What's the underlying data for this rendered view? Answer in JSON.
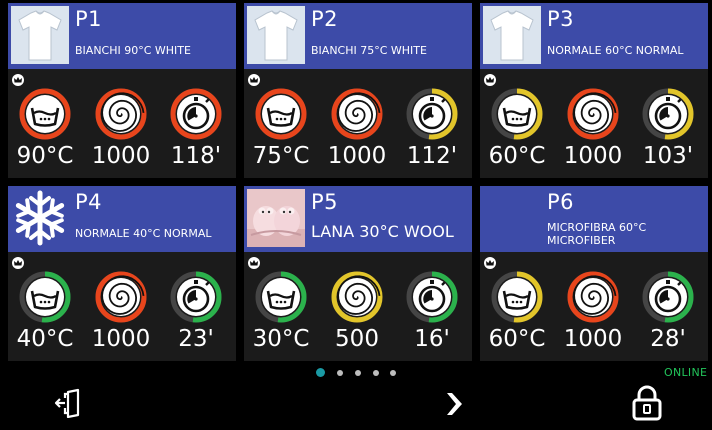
{
  "programs": [
    {
      "number": "P1",
      "name": "BIANCHI 90°C WHITE",
      "thumb": "tshirt-icon",
      "temp": "90°C",
      "spin": "1000",
      "time": "118'",
      "temp_color": "#e8451c",
      "spin_color": "#e8451c",
      "time_color": "#e8451c"
    },
    {
      "number": "P2",
      "name": "BIANCHI 75°C WHITE",
      "thumb": "tshirt-icon",
      "temp": "75°C",
      "spin": "1000",
      "time": "112'",
      "temp_color": "#e8451c",
      "spin_color": "#e8451c",
      "time_color": "#e2c52a"
    },
    {
      "number": "P3",
      "name": "NORMALE 60°C NORMAL",
      "thumb": "tshirt-icon",
      "temp": "60°C",
      "spin": "1000",
      "time": "103'",
      "temp_color": "#e2c52a",
      "spin_color": "#e8451c",
      "time_color": "#e2c52a"
    },
    {
      "number": "P4",
      "name": "NORMALE 40°C NORMAL",
      "thumb": "snowflake-icon",
      "temp": "40°C",
      "spin": "1000",
      "time": "23'",
      "temp_color": "#2bb24c",
      "spin_color": "#e8451c",
      "time_color": "#2bb24c"
    },
    {
      "number": "P5",
      "name": "LANA 30°C WOOL",
      "thumb": "wool-slippers-photo",
      "temp": "30°C",
      "spin": "500",
      "time": "16'",
      "temp_color": "#2bb24c",
      "spin_color": "#e2c52a",
      "time_color": "#2bb24c"
    },
    {
      "number": "P6",
      "name": "MICROFIBRA 60°C MICROFIBER",
      "thumb": "",
      "temp": "60°C",
      "spin": "1000",
      "time": "28'",
      "temp_color": "#e2c52a",
      "spin_color": "#e8451c",
      "time_color": "#2bb24c"
    }
  ],
  "pagination": {
    "pages": 5,
    "current": 1
  },
  "status": {
    "online": "ONLINE"
  },
  "toolbar": {
    "exit_icon": "exit-door-icon",
    "next_icon": "chevron-right-icon",
    "lock_icon": "lock-icon"
  },
  "colors": {
    "header": "#3d4ba8",
    "card": "#1b1b1b",
    "active_dot": "#1a9aa4",
    "online": "#22c35a"
  }
}
